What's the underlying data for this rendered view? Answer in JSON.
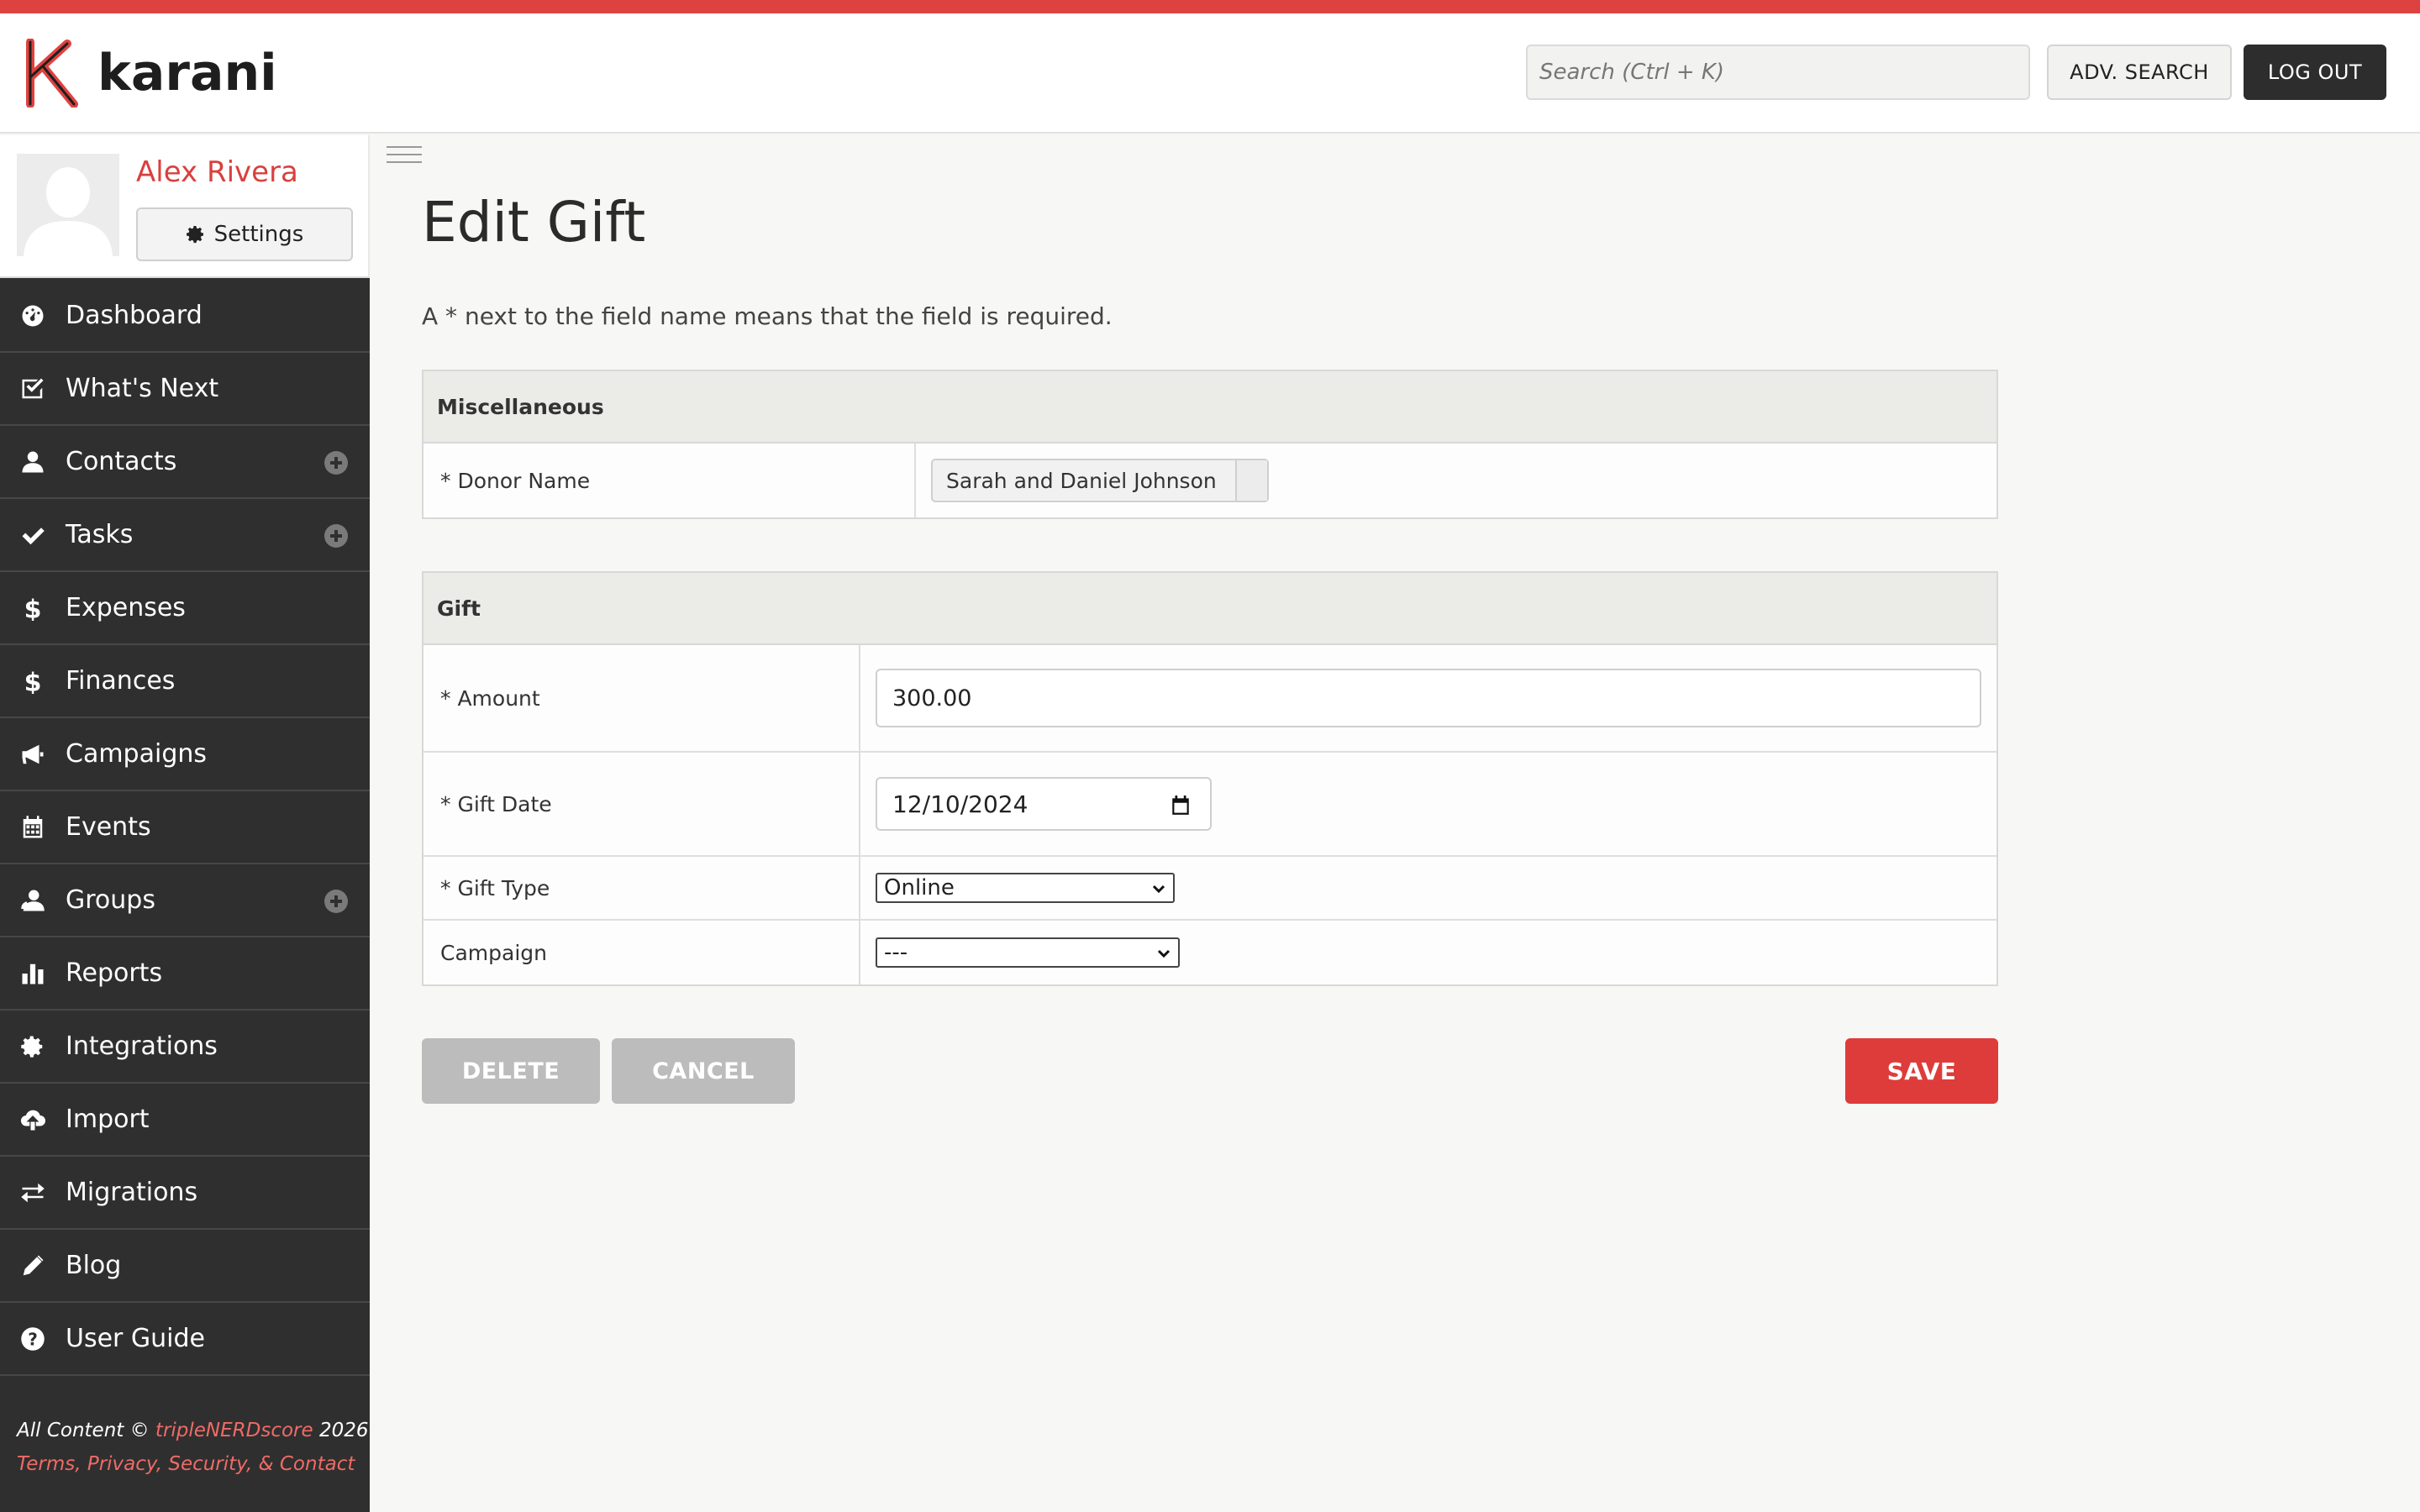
{
  "brand": {
    "name": "karani",
    "accent": "#de4240"
  },
  "header": {
    "search_placeholder": "Search (Ctrl + K)",
    "adv_search_label": "ADV. SEARCH",
    "logout_label": "LOG OUT"
  },
  "profile": {
    "name": "Alex Rivera",
    "settings_label": "Settings"
  },
  "nav": [
    {
      "label": "Dashboard",
      "icon": "dashboard-icon",
      "plus": false
    },
    {
      "label": "What's Next",
      "icon": "check-square-icon",
      "plus": false
    },
    {
      "label": "Contacts",
      "icon": "user-icon",
      "plus": true
    },
    {
      "label": "Tasks",
      "icon": "check-icon",
      "plus": true
    },
    {
      "label": "Expenses",
      "icon": "dollar-icon",
      "plus": false
    },
    {
      "label": "Finances",
      "icon": "dollar-icon",
      "plus": false
    },
    {
      "label": "Campaigns",
      "icon": "megaphone-icon",
      "plus": false
    },
    {
      "label": "Events",
      "icon": "calendar-icon",
      "plus": false
    },
    {
      "label": "Groups",
      "icon": "users-icon",
      "plus": true
    },
    {
      "label": "Reports",
      "icon": "bar-chart-icon",
      "plus": false
    },
    {
      "label": "Integrations",
      "icon": "gear-icon",
      "plus": false
    },
    {
      "label": "Import",
      "icon": "cloud-upload-icon",
      "plus": false
    },
    {
      "label": "Migrations",
      "icon": "exchange-icon",
      "plus": false
    },
    {
      "label": "Blog",
      "icon": "pencil-icon",
      "plus": false
    },
    {
      "label": "User Guide",
      "icon": "question-icon",
      "plus": false
    }
  ],
  "footer": {
    "prefix": "All Content © ",
    "company": "tripleNERDscore",
    "year": " 2026",
    "links": "Terms, Privacy, Security, & Contact"
  },
  "page": {
    "title": "Edit Gift",
    "hint": "A * next to the field name means that the field is required."
  },
  "misc_section": {
    "heading": "Miscellaneous",
    "donor_label": "* Donor Name",
    "donor_value": "Sarah and Daniel Johnson"
  },
  "gift_section": {
    "heading": "Gift",
    "amount_label": "* Amount",
    "amount_value": "300.00",
    "date_label": "* Gift Date",
    "date_value": "12/10/2024",
    "type_label": "* Gift Type",
    "type_value": "Online",
    "campaign_label": "Campaign",
    "campaign_value": "---"
  },
  "actions": {
    "delete": "DELETE",
    "cancel": "CANCEL",
    "save": "SAVE"
  }
}
